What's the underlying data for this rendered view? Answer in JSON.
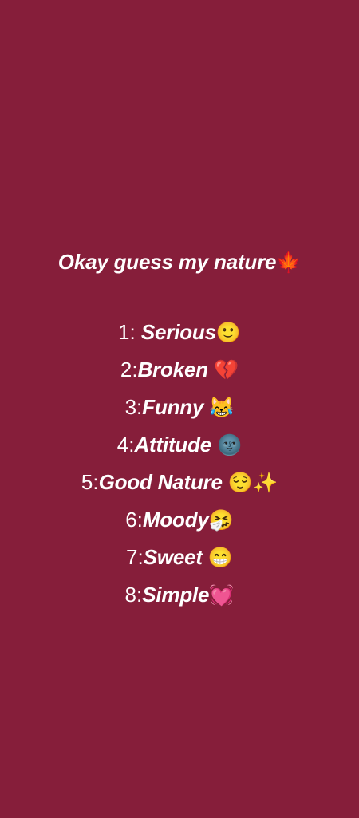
{
  "title": {
    "text": "Okay guess my nature",
    "emoji": "🍁"
  },
  "options": [
    {
      "number": "1: ",
      "label": "Serious",
      "emoji": "🙂"
    },
    {
      "number": "2:",
      "label": "Broken ",
      "emoji": "💔"
    },
    {
      "number": "3:",
      "label": "Funny ",
      "emoji": "😹"
    },
    {
      "number": "4:",
      "label": "Attitude ",
      "emoji": "🌚"
    },
    {
      "number": "5:",
      "label": "Good Nature ",
      "emoji": "😌✨"
    },
    {
      "number": "6:",
      "label": "Moody",
      "emoji": "🤧"
    },
    {
      "number": "7:",
      "label": "Sweet ",
      "emoji": "😁"
    },
    {
      "number": "8:",
      "label": "Simple",
      "emoji": "💓"
    }
  ],
  "colors": {
    "background": "#861E3A",
    "text": "#FFFFFF"
  }
}
